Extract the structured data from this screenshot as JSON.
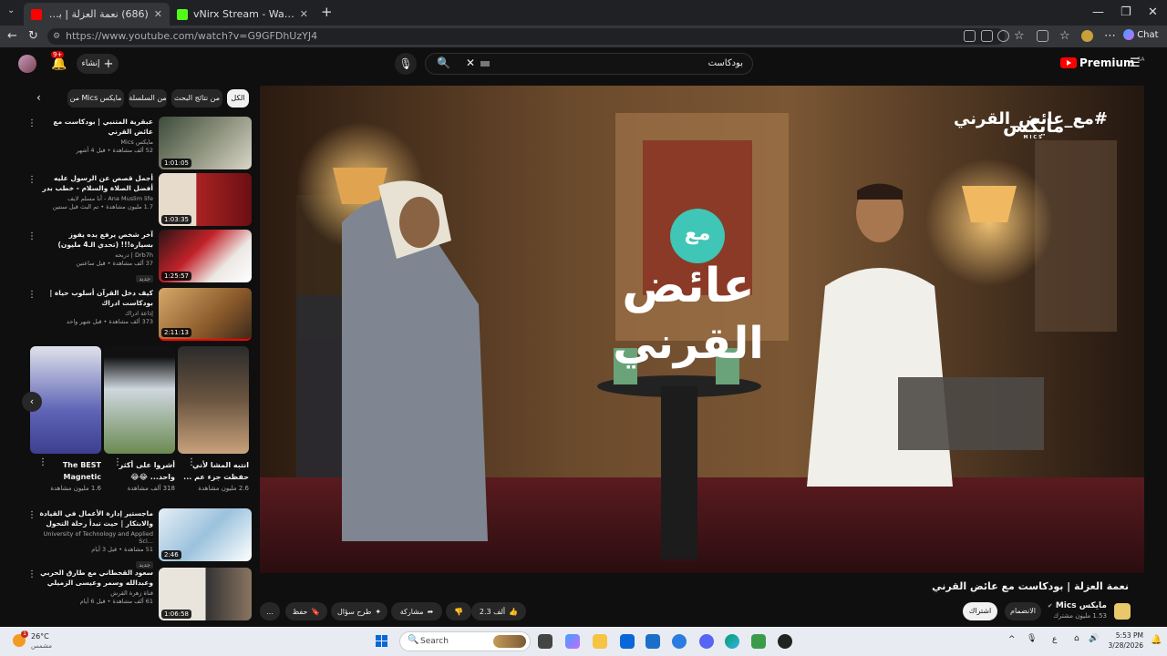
{
  "browser": {
    "tabs": [
      {
        "title": "(686) نعمة العزلة | بودكاست مع عائ",
        "active": true
      },
      {
        "title": "vNirx Stream - Watch Live on Kick",
        "active": false
      }
    ],
    "new_tab": "+",
    "url": "https://www.youtube.com/watch?v=G9GFDhUzYJ4",
    "chat_label": "Chat"
  },
  "yt_header": {
    "create_label": "إنشاء",
    "notif_count": "9+",
    "search_value": "بودكاست",
    "logo_text": "Premium",
    "logo_region": "SA"
  },
  "chips": [
    "الكل",
    "من نتائج البحث",
    "من السلسلة",
    "من Mics مايكس"
  ],
  "recommendations": [
    {
      "title": "عبقرية المتنبي | بودكاست مع عائض القرني",
      "channel": "مايكس Mics",
      "stats": "52 ألف مشاهدة • قبل 4 أشهر",
      "duration": "1:01:05"
    },
    {
      "title": "أجمل قصص عن الرسول عليه أفضل الصلاة والسلام - خطب بدر المشاري",
      "channel": "Ana Muslim life - أنا مسلم لايف",
      "stats": "1.7 مليون مشاهدة • تم البث قبل سنتين",
      "duration": "1:03:35"
    },
    {
      "title": "آخر شخص يرفع يده يفوز بسيارة!!! (تحدي الـ4 مليون)",
      "channel": "Drb7h | دربحه",
      "stats": "37 ألف مشاهدة • قبل ساعتين",
      "duration": "1:25:57",
      "badge": "جديد"
    },
    {
      "title": "كيف دخل القرآن أسلوب حياة | بودكاست ادراك",
      "channel": "إذاعة ادراك",
      "stats": "373 ألف مشاهدة • قبل شهر واحد",
      "duration": "2:11:13"
    },
    {
      "title": "ماجستير إدارة الأعمال في القيادة والابتكار | حيث تبدأ رحلة التحول القيادي #يوسف",
      "channel": "University of Technology and Applied Sci...",
      "stats": "51 مشاهدة • قبل 3 أيام",
      "duration": "2:46",
      "badge": "جديد"
    },
    {
      "title": "سعود القحطاني مع طارق الحربي وعبدالله وسمر وعيسى الزميلي اشترى بيت",
      "channel": "قناة زهرة القرش",
      "stats": "61 ألف مشاهدة • قبل 6 أيام",
      "duration": "1:06:58"
    }
  ],
  "shorts": [
    {
      "title": "انتبه المشا لأني حفظت جزء عم ...",
      "views": "2.6 مليون مشاهدة"
    },
    {
      "title": "أشروا على أكثر واحد... 😂😂",
      "views": "318 ألف مشاهدة"
    },
    {
      "title": "The BEST Magnetic",
      "views": "1.6 مليون مشاهدة"
    }
  ],
  "video": {
    "hashtag": "#مع_عائض_القرني",
    "brand": "مايكس",
    "brand_sub": "MICS",
    "logo_top": "مع",
    "logo_mid": "عائض",
    "logo_bot": "القرني",
    "title": "نعمة العزلة | بودكاست مع عائض القرني"
  },
  "channel": {
    "name": "مايكس Mics",
    "subs": "1.53 مليون مشترك",
    "join_label": "الانضمام",
    "subscribe_label": "اشتراك"
  },
  "actions": {
    "likes": "2.3 ألف",
    "share": "مشاركة",
    "ask": "طرح سؤال",
    "save": "حفظ",
    "more": "..."
  },
  "taskbar": {
    "weather_temp": "26°C",
    "weather_cond": "مشمس",
    "weather_badge": "1",
    "search_placeholder": "Search",
    "lang": "ع",
    "time": "5:53 PM",
    "date": "3/28/2026"
  }
}
